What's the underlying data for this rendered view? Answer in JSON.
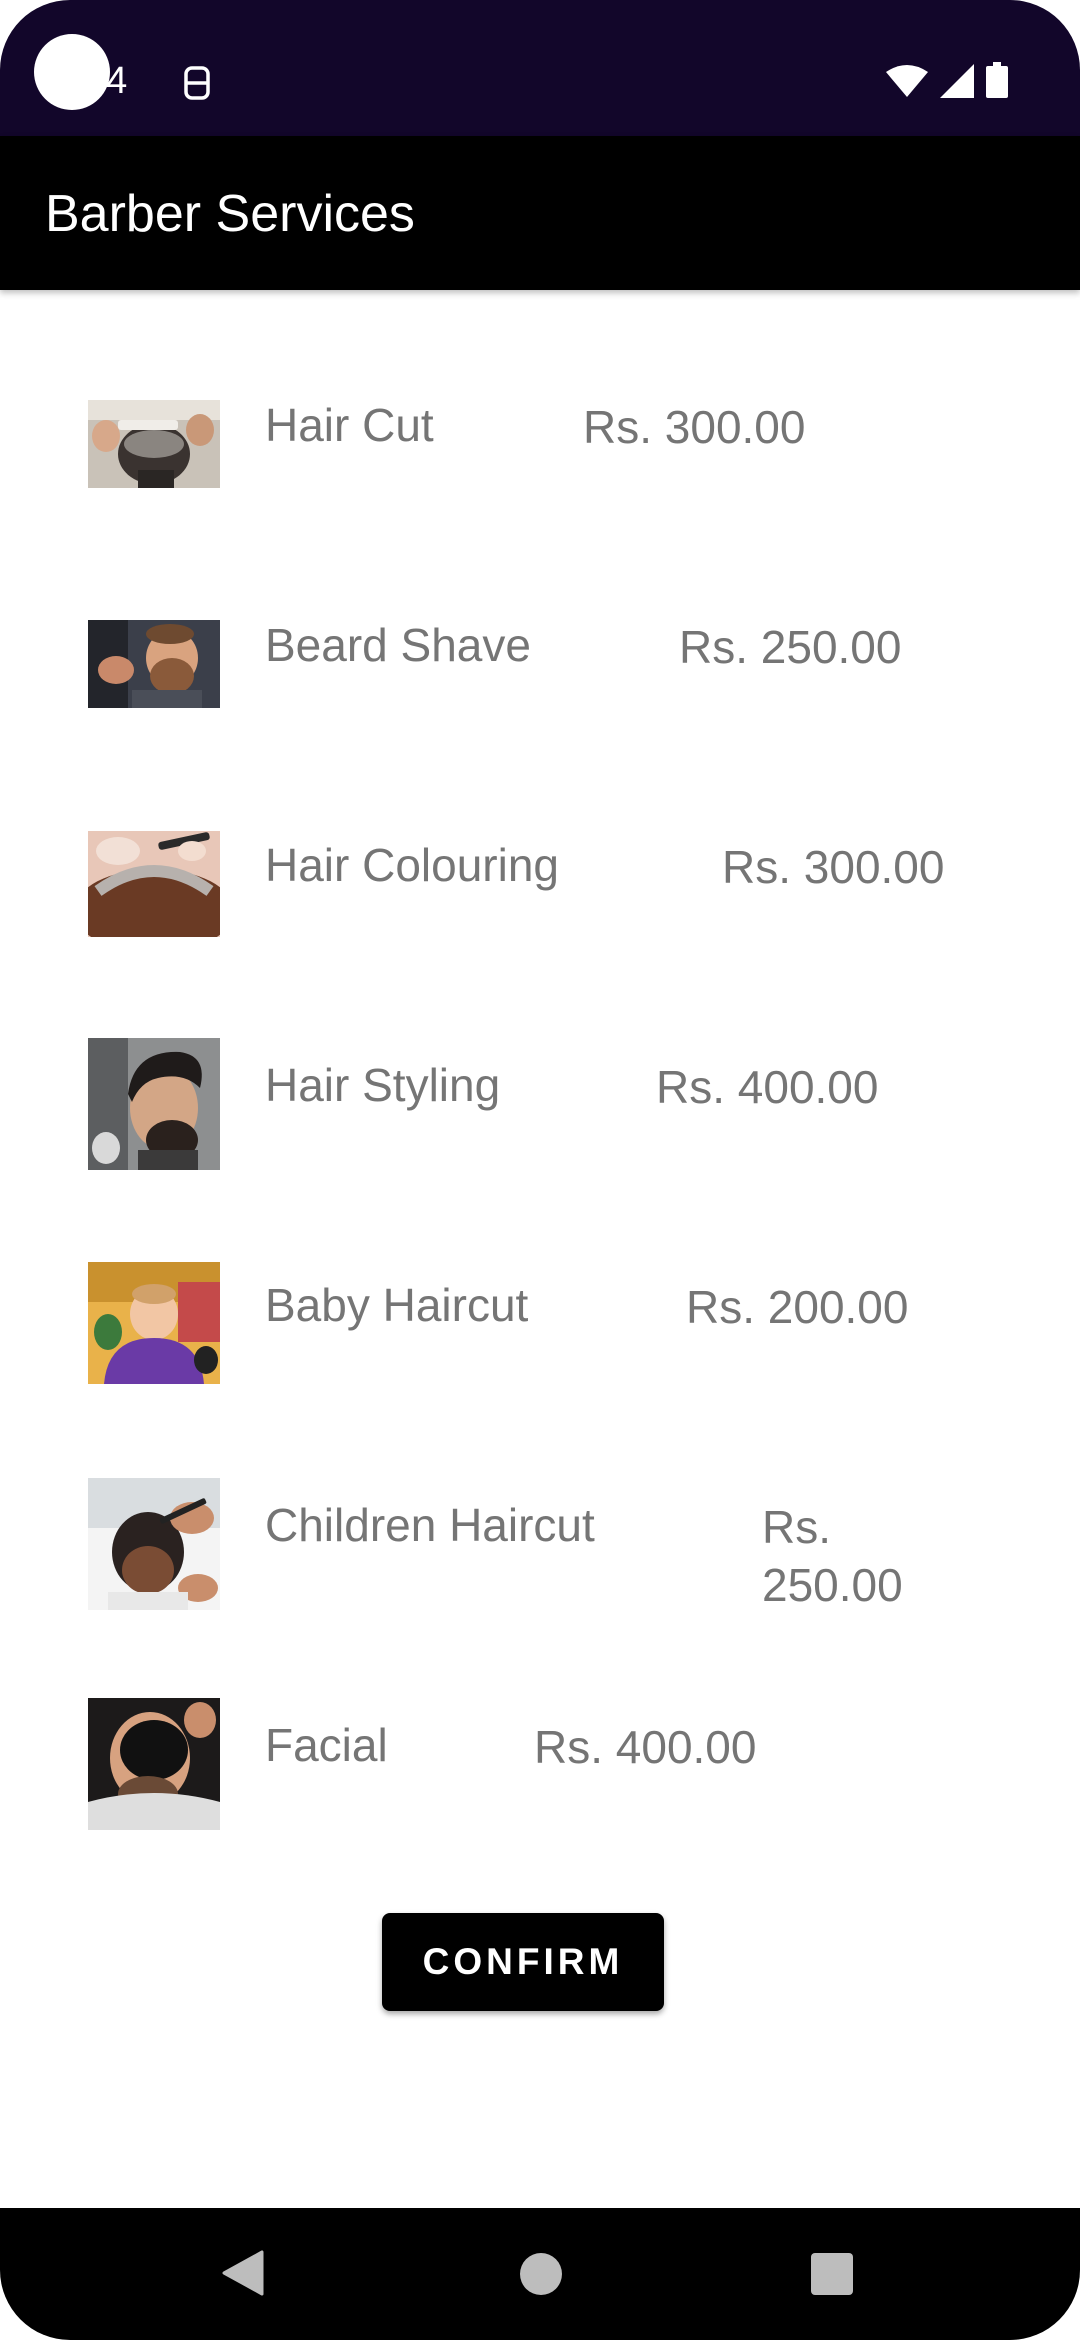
{
  "status_bar": {
    "time": "14",
    "sim_icon": "sim-card-icon",
    "wifi_icon": "wifi-icon",
    "signal_icon": "signal-icon",
    "battery_icon": "battery-icon"
  },
  "app_bar": {
    "title": "Barber Services"
  },
  "services": [
    {
      "name": "Hair Cut",
      "price": "Rs. 300.00",
      "thumbnail": "hair-cut-photo"
    },
    {
      "name": "Beard Shave",
      "price": "Rs. 250.00",
      "thumbnail": "beard-shave-photo"
    },
    {
      "name": "Hair Colouring",
      "price": "Rs. 300.00",
      "thumbnail": "hair-colouring-photo"
    },
    {
      "name": "Hair Styling",
      "price": "Rs. 400.00",
      "thumbnail": "hair-styling-photo"
    },
    {
      "name": "Baby Haircut",
      "price": "Rs. 200.00",
      "thumbnail": "baby-haircut-photo"
    },
    {
      "name": "Children Haircut",
      "price_line1": "Rs.",
      "price_line2": "250.00",
      "thumbnail": "children-haircut-photo"
    },
    {
      "name": "Facial",
      "price": "Rs. 400.00",
      "thumbnail": "facial-photo"
    }
  ],
  "confirm_label": "CONFIRM",
  "nav_bar": {
    "back_icon": "back-icon",
    "home_icon": "home-icon",
    "recents_icon": "recents-icon"
  },
  "colors": {
    "status_bar_bg": "#12062a",
    "app_bar_bg": "#000000",
    "text_secondary": "#757575",
    "button_bg": "#000000"
  }
}
